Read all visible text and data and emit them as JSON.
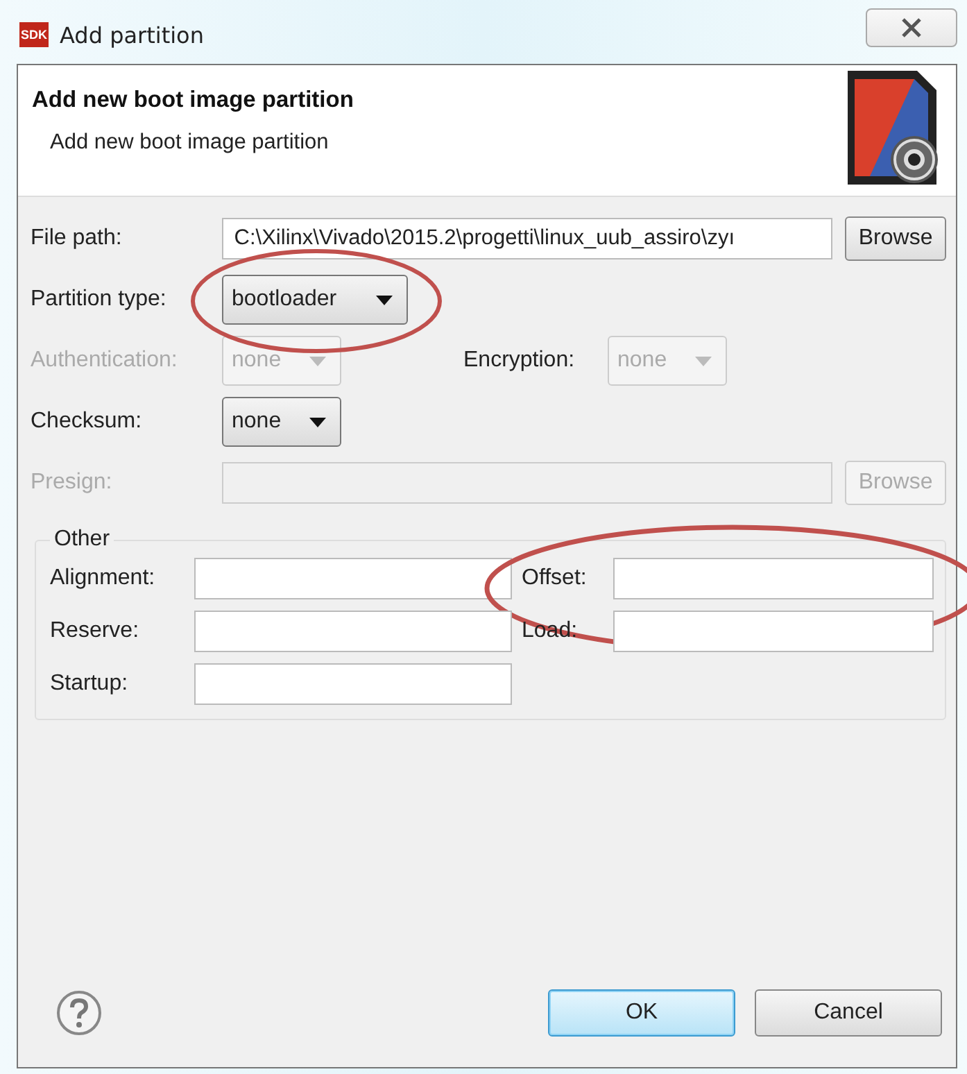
{
  "window": {
    "logo_text": "SDK",
    "title": "Add partition"
  },
  "header": {
    "title": "Add new boot image partition",
    "description": "Add new boot image partition"
  },
  "file_path": {
    "label": "File path:",
    "value": "C:\\Xilinx\\Vivado\\2015.2\\progetti\\linux_uub_assiro\\zyı",
    "button": "Browse"
  },
  "partition_type": {
    "label": "Partition type:",
    "value": "bootloader",
    "disabled": false,
    "highlighted": true
  },
  "authentication": {
    "label": "Authentication:",
    "value": "none",
    "disabled": true
  },
  "encryption": {
    "label": "Encryption:",
    "value": "none",
    "disabled": true
  },
  "checksum": {
    "label": "Checksum:",
    "value": "none",
    "disabled": false
  },
  "presign": {
    "label": "Presign:",
    "disabled": true,
    "button": "Browse"
  },
  "other": {
    "title": "Other",
    "fields": [
      {
        "label": "Alignment:",
        "highlighted": false
      },
      {
        "label": "Offset:",
        "highlighted": true
      },
      {
        "label": "Reserve:",
        "highlighted": false
      },
      {
        "label": "Load:",
        "highlighted": false
      },
      {
        "label": "Startup:",
        "highlighted": false
      }
    ]
  },
  "buttons": [
    {
      "label": "OK",
      "default": true
    },
    {
      "label": "Cancel",
      "default": false
    }
  ]
}
